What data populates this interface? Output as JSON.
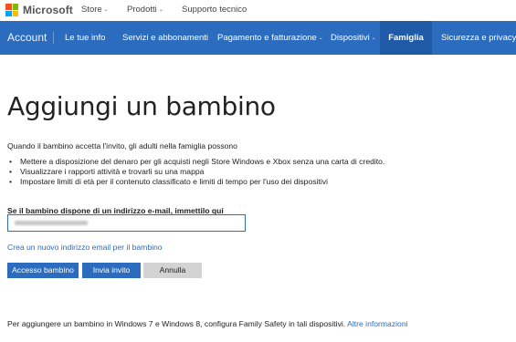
{
  "brand": {
    "name": "Microsoft",
    "logo_colors": [
      "#f25022",
      "#7fba00",
      "#00a4ef",
      "#ffb900"
    ]
  },
  "top_nav": {
    "store": "Store",
    "products": "Prodotti",
    "support": "Supporto tecnico"
  },
  "account_nav": {
    "title": "Account",
    "items": [
      {
        "label": "Le tue info"
      },
      {
        "label": "Servizi e abbonamenti"
      },
      {
        "label": "Pagamento e fatturazione"
      },
      {
        "label": "Dispositivi"
      },
      {
        "label": "Famiglia",
        "active": true
      },
      {
        "label": "Sicurezza e privacy"
      }
    ]
  },
  "main": {
    "title": "Aggiungi un bambino",
    "intro": "Quando il bambino accetta l'invito, gli adulti nella famiglia possono",
    "bullets": [
      "Mettere a disposizione del denaro per gli acquisti negli Store Windows e Xbox senza una carta di credito.",
      "Visualizzare i rapporti attività e trovarli su una mappa",
      "Impostare limiti di età per il contenuto classificato e limiti di tempo per l'uso dei dispositivi"
    ],
    "email_label": "Se il bambino dispone di un indirizzo e-mail, immettilo qui",
    "email_value": "",
    "create_link": "Crea un nuovo indirizzo email per il bambino",
    "buttons": {
      "access": "Accesso bambino",
      "invite": "Invia invito",
      "cancel": "Annulla"
    },
    "footer_text": "Per aggiungere un bambino in Windows 7 e Windows 8, configura Family Safety in tali dispositivi.",
    "footer_link": "Altre informazioni"
  },
  "colors": {
    "nav_blue": "#2b6cbf",
    "nav_active": "#1f5aa6",
    "button_grey": "#d3d3d3"
  }
}
